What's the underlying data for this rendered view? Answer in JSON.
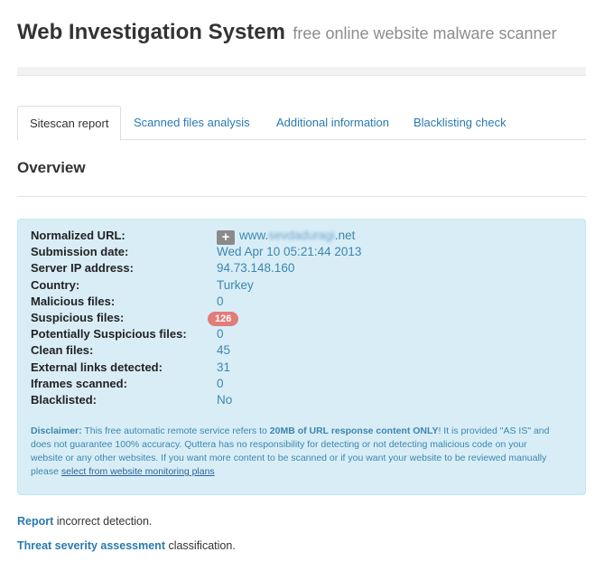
{
  "header": {
    "title": "Web Investigation System",
    "subtitle": "free online website malware scanner"
  },
  "progress": {
    "percent": 100
  },
  "tabs": [
    {
      "label": "Sitescan report",
      "active": true
    },
    {
      "label": "Scanned files analysis",
      "active": false
    },
    {
      "label": "Additional information",
      "active": false
    },
    {
      "label": "Blacklisting check",
      "active": false
    }
  ],
  "section": {
    "title": "Overview"
  },
  "report": {
    "normalized_url": {
      "label": "Normalized URL:",
      "prefix": "www.",
      "domain": "sevdaduragi",
      "suffix": ".net"
    },
    "submission_date": {
      "label": "Submission date:",
      "value": "Wed Apr 10 05:21:44 2013"
    },
    "server_ip": {
      "label": "Server IP address:",
      "value": "94.73.148.160"
    },
    "country": {
      "label": "Country:",
      "value": "Turkey"
    },
    "malicious_files": {
      "label": "Malicious files:",
      "value": "0"
    },
    "suspicious_files": {
      "label": "Suspicious files:",
      "value": "126"
    },
    "potentially_suspicious_files": {
      "label": "Potentially Suspicious files:",
      "value": "0"
    },
    "clean_files": {
      "label": "Clean files:",
      "value": "45"
    },
    "external_links": {
      "label": "External links detected:",
      "value": "31"
    },
    "iframes": {
      "label": "Iframes scanned:",
      "value": "0"
    },
    "blacklisted": {
      "label": "Blacklisted:",
      "value": "No"
    }
  },
  "disclaimer": {
    "heading": "Disclaimer:",
    "text1": " This free automatic remote service refers to ",
    "bold": "20MB of URL response content ONLY",
    "text2": "! It is provided \"AS IS\" and does not guarantee 100% accuracy. Quttera has no responsibility for detecting or not detecting malicious code on your website or any other websites. If you want more content to be scanned or if you want your website to be reviewed manually please ",
    "link": "select from website monitoring plans"
  },
  "footer": {
    "report_link": "Report",
    "report_text": " incorrect detection.",
    "threat_link": "Threat severity assessment",
    "threat_text": " classification."
  },
  "colors": {
    "link": "#2a7ab0",
    "panel_bg": "#d9edf7",
    "value_text": "#3a87ad",
    "badge": "#e27c79"
  }
}
